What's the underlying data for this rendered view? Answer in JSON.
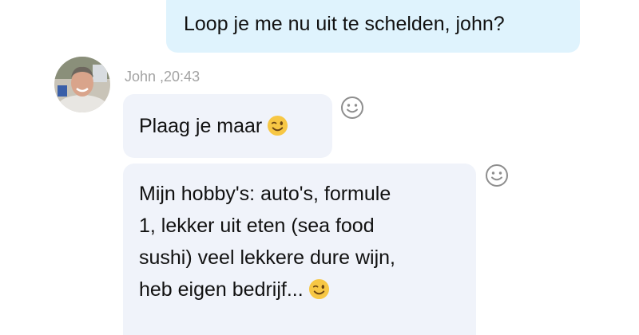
{
  "conversation": {
    "outgoing_message": {
      "text": "Loop je me nu uit te schelden, john?"
    },
    "incoming": {
      "sender_label": "John ,20:43",
      "avatar_icon": "profile-photo",
      "messages": [
        {
          "lines": [
            "Plaag je maar"
          ],
          "emoji": "winking-face-icon"
        },
        {
          "lines": [
            "Mijn hobby's: auto's, formule",
            "1, lekker uit eten (sea food",
            "sushi) veel lekkere dure wijn,",
            "heb eigen bedrijf..."
          ],
          "emoji": "winking-face-icon"
        }
      ]
    }
  },
  "colors": {
    "outgoing_bubble": "#dff3fd",
    "incoming_bubble": "#f0f3fa",
    "timestamp": "#a3a3a3",
    "reaction_icon": "#8e8e8e",
    "emoji_yellow": "#f7c744"
  }
}
